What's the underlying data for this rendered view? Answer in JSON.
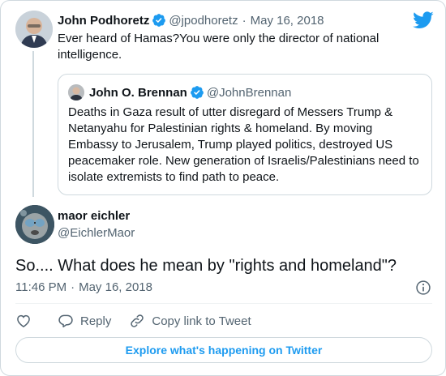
{
  "colors": {
    "accent": "#1d9bf0",
    "text": "#0f1419",
    "secondary": "#536471",
    "border": "#cfd9de"
  },
  "parent_tweet": {
    "author_name": "John Podhoretz",
    "handle": "@jpodhoretz",
    "separator": "·",
    "date": "May 16, 2018",
    "text": "Ever heard of Hamas?You were only the director of national intelligence.",
    "verified": true
  },
  "quoted_tweet": {
    "author_name": "John O. Brennan",
    "handle": "@JohnBrennan",
    "verified": true,
    "text": "Deaths in Gaza result of utter disregard of Messers Trump & Netanyahu for Palestinian rights & homeland. By moving Embassy to Jerusalem, Trump played politics, destroyed US peacemaker role. New generation of Israelis/Palestinians need to isolate extremists to find path to peace."
  },
  "main_tweet": {
    "author_name": "maor eichler",
    "handle": "@EichlerMaor",
    "text": "So.... What does he mean by \"rights and homeland\"?",
    "time": "11:46 PM",
    "separator": "·",
    "date": "May 16, 2018"
  },
  "actions": {
    "reply_label": "Reply",
    "copy_link_label": "Copy link to Tweet"
  },
  "explore_label": "Explore what's happening on Twitter",
  "icons": [
    "twitter-bird-icon",
    "verified-badge-icon",
    "info-icon",
    "heart-icon",
    "reply-icon",
    "link-icon"
  ]
}
